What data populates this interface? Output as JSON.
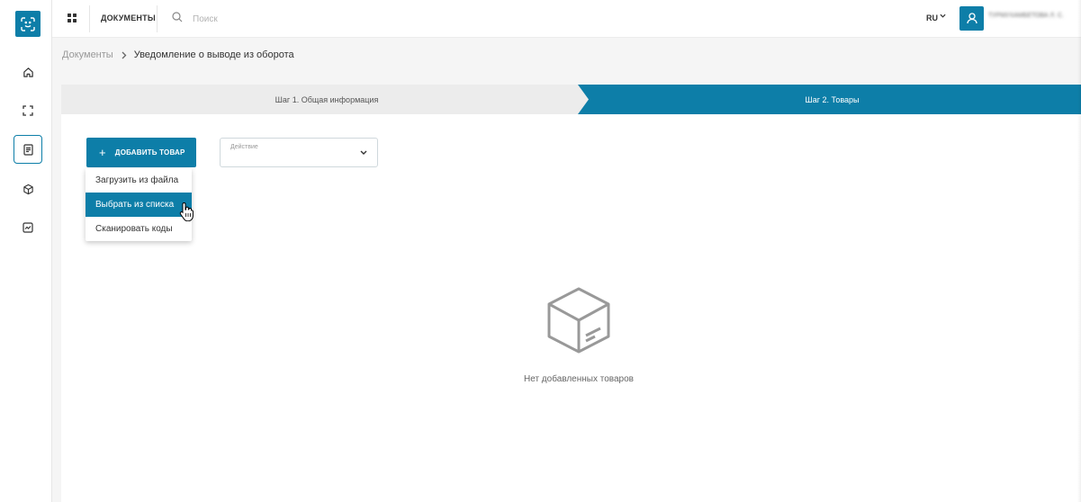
{
  "header": {
    "section_title": "ДОКУМЕНТЫ",
    "search_placeholder": "Поиск",
    "language": "RU",
    "user_name": "ТУРМУХАМБЕТОВА Л. С."
  },
  "breadcrumb": {
    "parent": "Документы",
    "current": "Уведомление о выводе из оборота"
  },
  "steps": [
    {
      "label": "Шаг 1. Общая информация",
      "active": false
    },
    {
      "label": "Шаг 2. Товары",
      "active": true
    }
  ],
  "toolbar": {
    "add_button_label": "ДОБАВИТЬ ТОВАР",
    "action_label": "Действие"
  },
  "add_menu": {
    "items": [
      {
        "label": "Загрузить из файла",
        "highlighted": false
      },
      {
        "label": "Выбрать из списка",
        "highlighted": true
      },
      {
        "label": "Сканировать коды",
        "highlighted": false
      }
    ]
  },
  "empty_state": {
    "text": "Нет добавленных товаров",
    "icon": "box-icon"
  },
  "sidebar": {
    "items": [
      {
        "icon": "home-icon",
        "active": false
      },
      {
        "icon": "scan-icon",
        "active": false
      },
      {
        "icon": "document-icon",
        "active": true
      },
      {
        "icon": "cube-icon",
        "active": false
      },
      {
        "icon": "report-icon",
        "active": false
      }
    ]
  },
  "colors": {
    "primary": "#0d7ea8",
    "background": "#f5f5f5",
    "step_inactive": "#ececec"
  }
}
